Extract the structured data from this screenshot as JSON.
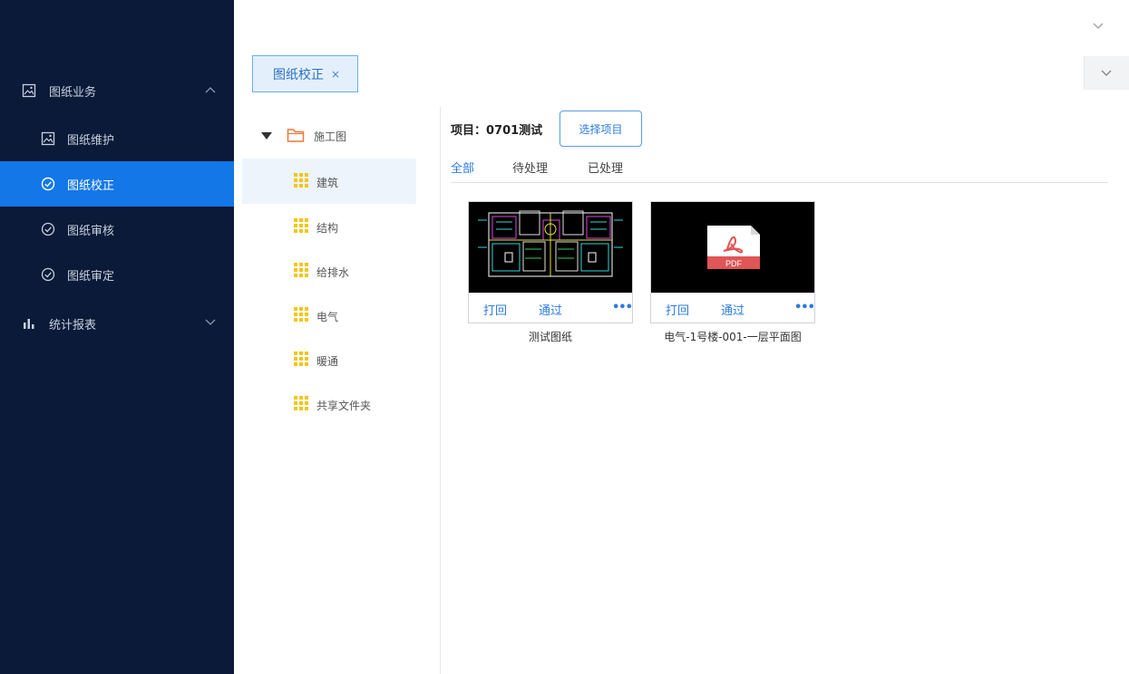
{
  "sidebar": {
    "groups": [
      {
        "label": "图纸业务",
        "icon": "image-icon"
      },
      {
        "label": "统计报表",
        "icon": "bar-chart-icon"
      }
    ],
    "items": [
      {
        "label": "图纸维护",
        "icon": "image-icon"
      },
      {
        "label": "图纸校正",
        "icon": "check-circle-icon"
      },
      {
        "label": "图纸审核",
        "icon": "check-circle-icon"
      },
      {
        "label": "图纸审定",
        "icon": "check-circle-icon"
      }
    ],
    "active_item": "图纸校正"
  },
  "tabs": [
    {
      "label": "图纸校正",
      "close": "×"
    }
  ],
  "tree": {
    "root": {
      "label": "施工图",
      "icon": "folder-icon"
    },
    "children": [
      {
        "label": "建筑"
      },
      {
        "label": "结构"
      },
      {
        "label": "给排水"
      },
      {
        "label": "电气"
      },
      {
        "label": "暖通"
      },
      {
        "label": "共享文件夹"
      }
    ],
    "selected": "建筑"
  },
  "main": {
    "project_label": "项目：0701测试",
    "select_button": "选择项目",
    "filter_tabs": [
      "全部",
      "待处理",
      "已处理"
    ],
    "active_filter": "全部",
    "cards": [
      {
        "name": "测试图纸",
        "thumb": "cad-drawing",
        "reject": "打回",
        "approve": "通过",
        "more": "•••"
      },
      {
        "name": "电气-1号楼-001-一层平面图",
        "thumb": "pdf-icon",
        "pdf_text": "PDF",
        "reject": "打回",
        "approve": "通过",
        "more": "•••"
      }
    ]
  },
  "colors": {
    "sidebar_bg": "#0a1a38",
    "accent": "#1377e8",
    "link": "#2b7ae0",
    "tree_icon": "#f5c518",
    "folder_icon": "#e8793a"
  }
}
